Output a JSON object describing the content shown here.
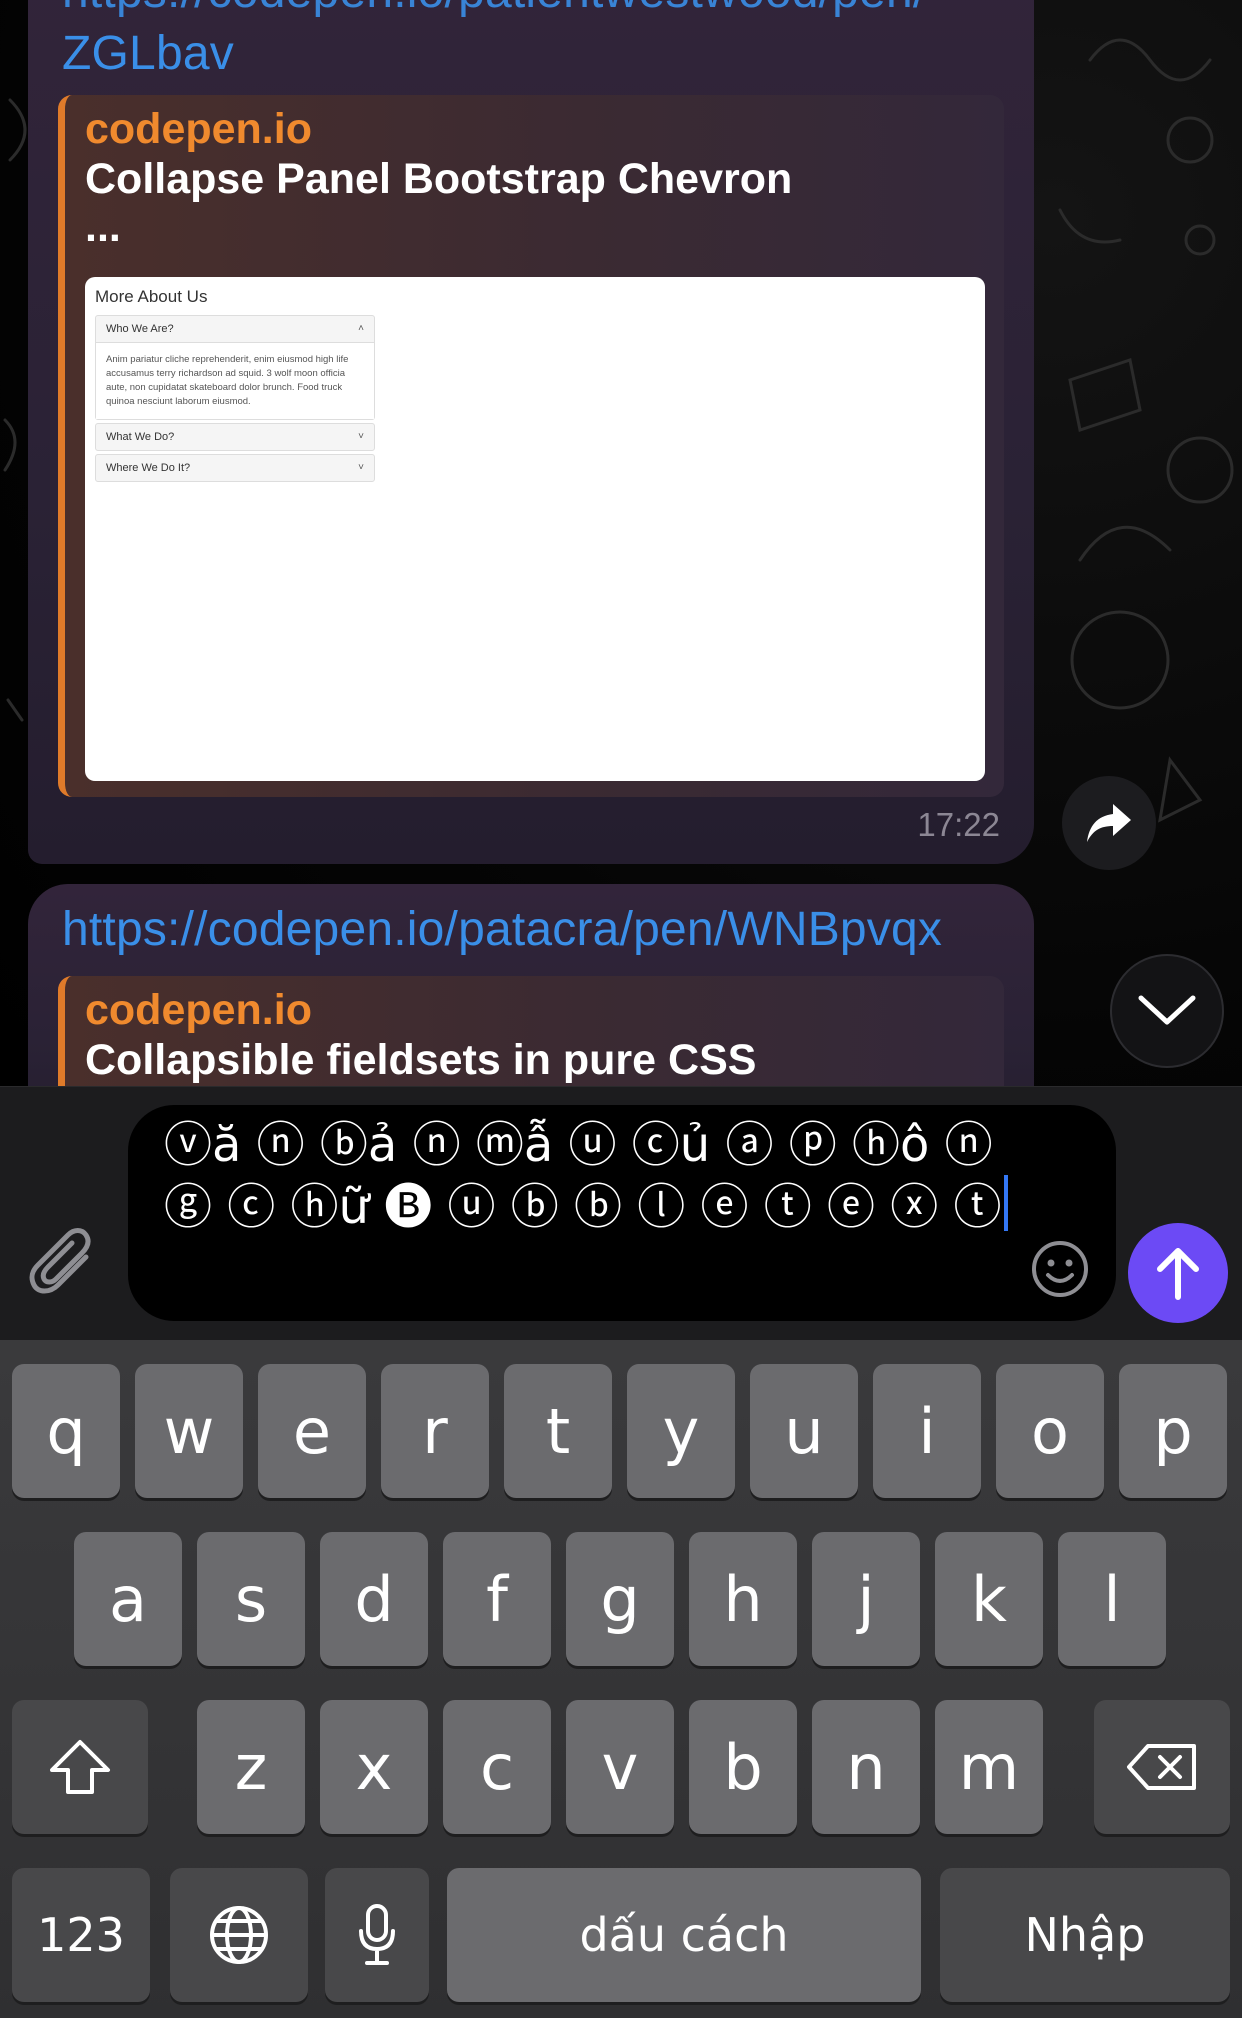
{
  "chat": {
    "message1": {
      "url_partial_line": "https://codepen.io/patientwestwood/pen/",
      "url_line2": "ZGLbav",
      "preview": {
        "site": "codepen.io",
        "title": "Collapse Panel Bootstrap Chevron",
        "ellipsis": "...",
        "image": {
          "heading": "More About Us",
          "panels": [
            {
              "title": "Who We Are?",
              "chevron": "˄",
              "body": "Anim pariatur cliche reprehenderit, enim eiusmod high life accusamus terry richardson ad squid. 3 wolf moon officia aute, non cupidatat skateboard dolor brunch. Food truck quinoa nesciunt laborum eiusmod."
            },
            {
              "title": "What We Do?",
              "chevron": "˅"
            },
            {
              "title": "Where We Do It?",
              "chevron": "˅"
            }
          ]
        }
      },
      "time": "17:22"
    },
    "message2": {
      "url": "https://codepen.io/patacra/pen/WNBpvqx",
      "preview": {
        "site": "codepen.io",
        "title": "Collapsible fieldsets in pure CSS"
      }
    },
    "share_icon": "share-arrow-icon",
    "scroll_down_icon": "chevron-down-icon"
  },
  "composer": {
    "attach_icon": "paperclip-icon",
    "input_value": "ⓥă ⓝ ⓑả ⓝ ⓜẫ ⓤ ⓒủ ⓐ ⓟ ⓗô ⓝ ⓖ ⓒ ⓗữ 🅑 ⓤ ⓑ ⓑ ⓛ ⓔ ⓣ ⓔ ⓧ ⓣ",
    "emoji_icon": "smiley-icon",
    "send_icon": "arrow-up-icon",
    "send_color": "#6c4af5"
  },
  "keyboard": {
    "row1": [
      "q",
      "w",
      "e",
      "r",
      "t",
      "y",
      "u",
      "i",
      "o",
      "p"
    ],
    "row2": [
      "a",
      "s",
      "d",
      "f",
      "g",
      "h",
      "j",
      "k",
      "l"
    ],
    "row3": [
      "z",
      "x",
      "c",
      "v",
      "b",
      "n",
      "m"
    ],
    "shift_icon": "shift-icon",
    "backspace_icon": "backspace-icon",
    "numbers_label": "123",
    "globe_icon": "globe-icon",
    "mic_icon": "microphone-icon",
    "space_label": "dấu cách",
    "return_label": "Nhập"
  }
}
